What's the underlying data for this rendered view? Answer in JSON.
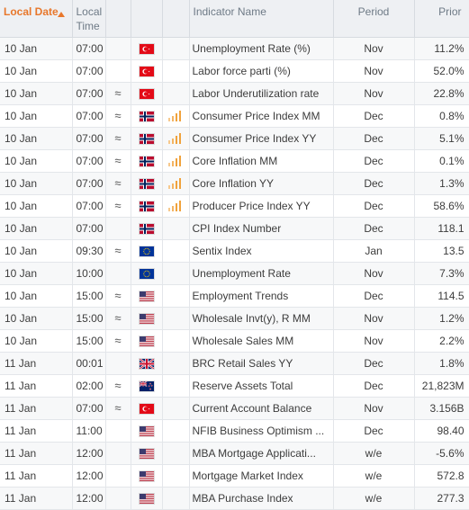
{
  "header": {
    "local_date": "Local Date",
    "local_time": "Local Time",
    "indicator_name": "Indicator Name",
    "period": "Period",
    "prior": "Prior"
  },
  "colors": {
    "accent": "#e8772b",
    "header_bg": "#eef0f3",
    "bars": "#f0a23c"
  },
  "rows": [
    {
      "date": "10 Jan",
      "time": "07:00",
      "volatile": "",
      "flag": "turkey-flag-icon",
      "country": "TR",
      "impact": false,
      "name": "Unemployment Rate (%)",
      "period": "Nov",
      "prior": "11.2%"
    },
    {
      "date": "10 Jan",
      "time": "07:00",
      "volatile": "",
      "flag": "turkey-flag-icon",
      "country": "TR",
      "impact": false,
      "name": "Labor force parti (%)",
      "period": "Nov",
      "prior": "52.0%"
    },
    {
      "date": "10 Jan",
      "time": "07:00",
      "volatile": "≈",
      "flag": "turkey-flag-icon",
      "country": "TR",
      "impact": false,
      "name": "Labor Underutilization rate",
      "period": "Nov",
      "prior": "22.8%"
    },
    {
      "date": "10 Jan",
      "time": "07:00",
      "volatile": "≈",
      "flag": "norway-flag-icon",
      "country": "NO",
      "impact": true,
      "name": "Consumer Price Index MM",
      "period": "Dec",
      "prior": "0.8%"
    },
    {
      "date": "10 Jan",
      "time": "07:00",
      "volatile": "≈",
      "flag": "norway-flag-icon",
      "country": "NO",
      "impact": true,
      "name": "Consumer Price Index YY",
      "period": "Dec",
      "prior": "5.1%"
    },
    {
      "date": "10 Jan",
      "time": "07:00",
      "volatile": "≈",
      "flag": "norway-flag-icon",
      "country": "NO",
      "impact": true,
      "name": "Core Inflation MM",
      "period": "Dec",
      "prior": "0.1%"
    },
    {
      "date": "10 Jan",
      "time": "07:00",
      "volatile": "≈",
      "flag": "norway-flag-icon",
      "country": "NO",
      "impact": true,
      "name": "Core Inflation YY",
      "period": "Dec",
      "prior": "1.3%"
    },
    {
      "date": "10 Jan",
      "time": "07:00",
      "volatile": "≈",
      "flag": "norway-flag-icon",
      "country": "NO",
      "impact": true,
      "name": "Producer Price Index YY",
      "period": "Dec",
      "prior": "58.6%"
    },
    {
      "date": "10 Jan",
      "time": "07:00",
      "volatile": "",
      "flag": "norway-flag-icon",
      "country": "NO",
      "impact": false,
      "name": "CPI Index Number",
      "period": "Dec",
      "prior": "118.1"
    },
    {
      "date": "10 Jan",
      "time": "09:30",
      "volatile": "≈",
      "flag": "eu-flag-icon",
      "country": "EU",
      "impact": false,
      "name": "Sentix Index",
      "period": "Jan",
      "prior": "13.5"
    },
    {
      "date": "10 Jan",
      "time": "10:00",
      "volatile": "",
      "flag": "eu-flag-icon",
      "country": "EU",
      "impact": false,
      "name": "Unemployment Rate",
      "period": "Nov",
      "prior": "7.3%"
    },
    {
      "date": "10 Jan",
      "time": "15:00",
      "volatile": "≈",
      "flag": "us-flag-icon",
      "country": "US",
      "impact": false,
      "name": "Employment Trends",
      "period": "Dec",
      "prior": "114.5"
    },
    {
      "date": "10 Jan",
      "time": "15:00",
      "volatile": "≈",
      "flag": "us-flag-icon",
      "country": "US",
      "impact": false,
      "name": "Wholesale Invt(y), R MM",
      "period": "Nov",
      "prior": "1.2%"
    },
    {
      "date": "10 Jan",
      "time": "15:00",
      "volatile": "≈",
      "flag": "us-flag-icon",
      "country": "US",
      "impact": false,
      "name": "Wholesale Sales MM",
      "period": "Nov",
      "prior": "2.2%"
    },
    {
      "date": "11 Jan",
      "time": "00:01",
      "volatile": "",
      "flag": "uk-flag-icon",
      "country": "GB",
      "impact": false,
      "name": "BRC Retail Sales YY",
      "period": "Dec",
      "prior": "1.8%"
    },
    {
      "date": "11 Jan",
      "time": "02:00",
      "volatile": "≈",
      "flag": "nz-flag-icon",
      "country": "NZ",
      "impact": false,
      "name": "Reserve Assets Total",
      "period": "Dec",
      "prior": "21,823M"
    },
    {
      "date": "11 Jan",
      "time": "07:00",
      "volatile": "≈",
      "flag": "turkey-flag-icon",
      "country": "TR",
      "impact": false,
      "name": "Current Account Balance",
      "period": "Nov",
      "prior": "3.156B"
    },
    {
      "date": "11 Jan",
      "time": "11:00",
      "volatile": "",
      "flag": "us-flag-icon",
      "country": "US",
      "impact": false,
      "name": "NFIB Business Optimism ...",
      "period": "Dec",
      "prior": "98.40"
    },
    {
      "date": "11 Jan",
      "time": "12:00",
      "volatile": "",
      "flag": "us-flag-icon",
      "country": "US",
      "impact": false,
      "name": "MBA Mortgage Applicati...",
      "period": "w/e",
      "prior": "-5.6%"
    },
    {
      "date": "11 Jan",
      "time": "12:00",
      "volatile": "",
      "flag": "us-flag-icon",
      "country": "US",
      "impact": false,
      "name": "Mortgage Market Index",
      "period": "w/e",
      "prior": "572.8"
    },
    {
      "date": "11 Jan",
      "time": "12:00",
      "volatile": "",
      "flag": "us-flag-icon",
      "country": "US",
      "impact": false,
      "name": "MBA Purchase Index",
      "period": "w/e",
      "prior": "277.3"
    }
  ]
}
